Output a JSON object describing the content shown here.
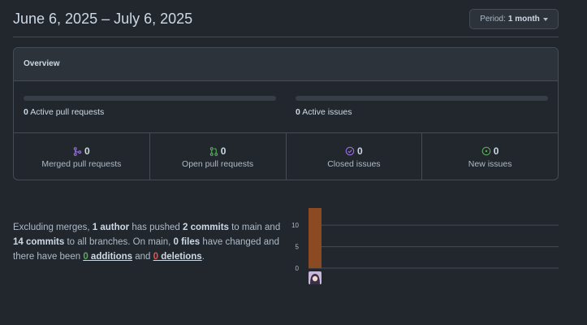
{
  "header": {
    "title": "June 6, 2025 – July 6, 2025",
    "period_label": "Period:",
    "period_value": "1 month"
  },
  "overview": {
    "title": "Overview",
    "active_pull_requests": {
      "count": "0",
      "label": "Active pull requests",
      "progress": 0
    },
    "active_issues": {
      "count": "0",
      "label": "Active issues",
      "progress": 0
    },
    "stats": [
      {
        "icon": "git-merge-icon",
        "count": "0",
        "label": "Merged pull requests",
        "color": "#986ee2"
      },
      {
        "icon": "git-pull-request-icon",
        "count": "0",
        "label": "Open pull requests",
        "color": "#57ab5a"
      },
      {
        "icon": "issue-closed-icon",
        "count": "0",
        "label": "Closed issues",
        "color": "#986ee2"
      },
      {
        "icon": "issue-opened-icon",
        "count": "0",
        "label": "New issues",
        "color": "#57ab5a"
      }
    ]
  },
  "summary": {
    "t1": "Excluding merges, ",
    "authors": "1 author",
    "t2": " has pushed ",
    "commits_main": "2 commits",
    "t3": " to main and ",
    "commits_all": "14 commits",
    "t4": " to all branches. On main, ",
    "files": "0 files",
    "t5": " have changed and there have been ",
    "additions_num": "0",
    "additions_word": " additions",
    "t6": " and ",
    "deletions_num": "0",
    "deletions_word": " deletions",
    "t7": "."
  },
  "colors": {
    "background": "#22272e",
    "border": "#444c56",
    "bar": "#8c4a22",
    "addition": "#57ab5a",
    "deletion": "#e5534b"
  },
  "chart_data": {
    "type": "bar",
    "categories": [
      ""
    ],
    "values": [
      14
    ],
    "ylim": [
      0,
      14
    ],
    "yticks": [
      "0",
      "5",
      "10"
    ],
    "grid": true
  }
}
